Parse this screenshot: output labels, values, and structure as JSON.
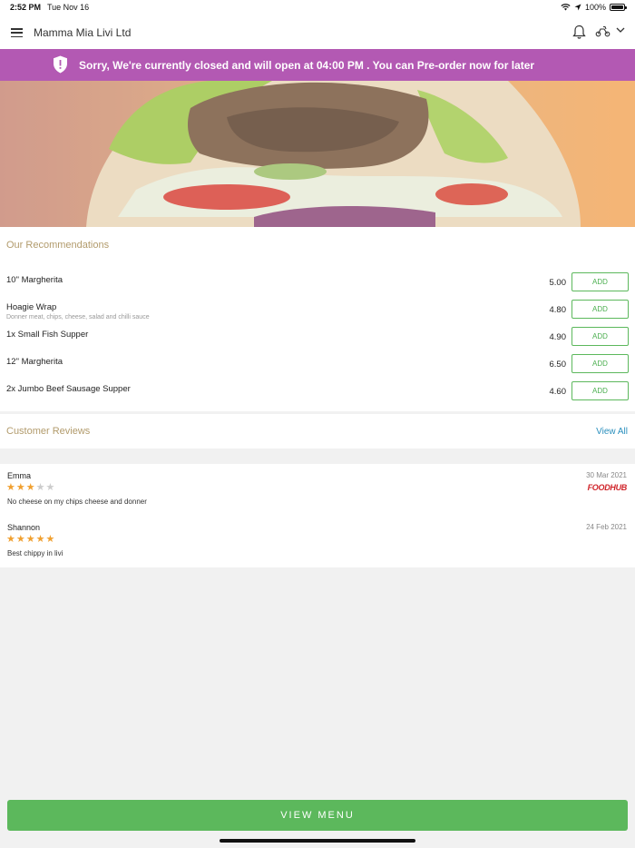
{
  "status_bar": {
    "time": "2:52 PM",
    "date": "Tue Nov 16",
    "battery": "100%"
  },
  "header": {
    "title": "Mamma Mia Livi Ltd"
  },
  "banner": {
    "text": "Sorry, We're currently closed and will open at 04:00 PM . You can Pre-order now for later"
  },
  "recommendations": {
    "title": "Our Recommendations",
    "add_label": "ADD",
    "items": [
      {
        "name": "10\" Margherita",
        "desc": "",
        "price": "5.00"
      },
      {
        "name": "Hoagie Wrap",
        "desc": "Donner meat, chips, cheese, salad and chilli sauce",
        "price": "4.80"
      },
      {
        "name": "1x Small Fish Supper",
        "desc": "",
        "price": "4.90"
      },
      {
        "name": "12\" Margherita",
        "desc": "",
        "price": "6.50"
      },
      {
        "name": "2x Jumbo Beef Sausage Supper",
        "desc": "",
        "price": "4.60"
      }
    ]
  },
  "reviews": {
    "title": "Customer Reviews",
    "view_all": "View All",
    "items": [
      {
        "name": "Emma",
        "date": "30 Mar 2021",
        "rating": 3,
        "text": "No cheese on my chips cheese and donner",
        "source": "FOODHUB"
      },
      {
        "name": "Shannon",
        "date": "24 Feb 2021",
        "rating": 5,
        "text": "Best chippy in livi",
        "source": ""
      }
    ]
  },
  "footer": {
    "view_menu": "VIEW MENU"
  },
  "colors": {
    "accent_green": "#5cb85c",
    "banner_purple": "#b359b3",
    "section_title": "#b29b6c",
    "link_blue": "#2a8fbd",
    "star": "#f0a030"
  }
}
